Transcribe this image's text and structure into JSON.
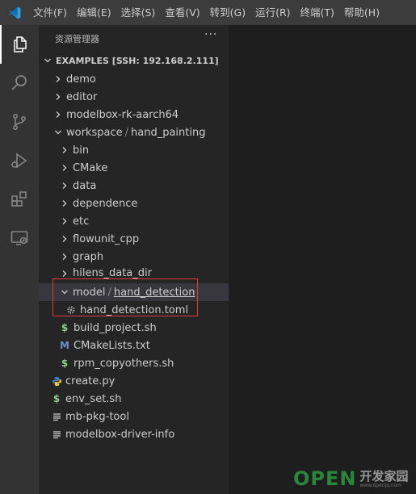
{
  "menu": {
    "items": [
      "文件(F)",
      "编辑(E)",
      "选择(S)",
      "查看(V)",
      "转到(G)",
      "运行(R)",
      "终端(T)",
      "帮助(H)"
    ]
  },
  "activity_bar": {
    "icons": [
      "explorer-icon",
      "search-icon",
      "source-control-icon",
      "run-debug-icon",
      "extensions-icon",
      "remote-explorer-icon"
    ]
  },
  "sidebar": {
    "title": "资源管理器",
    "more": "···",
    "section_title": "EXAMPLES [SSH: 192.168.2.111]",
    "tree": {
      "demo": "demo",
      "editor": "editor",
      "modelbox_rk": "modelbox-rk-aarch64",
      "workspace": "workspace",
      "hand_painting": "hand_painting",
      "bin": "bin",
      "cmake": "CMake",
      "data": "data",
      "dependence": "dependence",
      "etc": "etc",
      "flowunit_cpp": "flowunit_cpp",
      "graph": "graph",
      "hilens_data_dir": "hilens_data_dir",
      "model": "model",
      "hand_detection": "hand_detection",
      "hand_detection_toml": "hand_detection.toml",
      "build_project": "build_project.sh",
      "cmakelists": "CMakeLists.txt",
      "rpm_copyothers": "rpm_copyothers.sh",
      "create_py": "create.py",
      "env_set": "env_set.sh",
      "mb_pkg_tool": "mb-pkg-tool",
      "modelbox_driver_info": "modelbox-driver-info"
    },
    "separator": "/"
  },
  "watermark": {
    "brand": "OPEN",
    "cn": "开发家园",
    "sub": "www.openjq.com"
  },
  "colors": {
    "accent": "#0078d4",
    "highlight_box": "#e53935",
    "shell_script": "#89d185",
    "cmake": "#6d8fd2",
    "python": "#3e7bc0"
  }
}
